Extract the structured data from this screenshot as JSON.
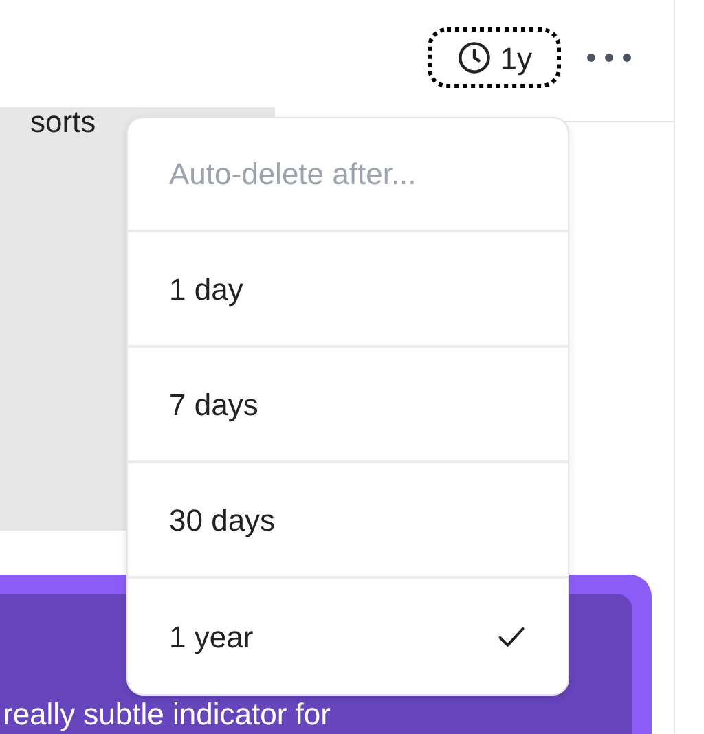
{
  "toolbar": {
    "retention_button": {
      "label": "1y"
    }
  },
  "content": {
    "note_text": "sorts",
    "card_text": "really subtle indicator for"
  },
  "menu": {
    "heading": "Auto-delete after...",
    "items": [
      {
        "label": "1 day",
        "selected": false
      },
      {
        "label": "7 days",
        "selected": false
      },
      {
        "label": "30 days",
        "selected": false
      },
      {
        "label": "1 year",
        "selected": true
      }
    ]
  }
}
